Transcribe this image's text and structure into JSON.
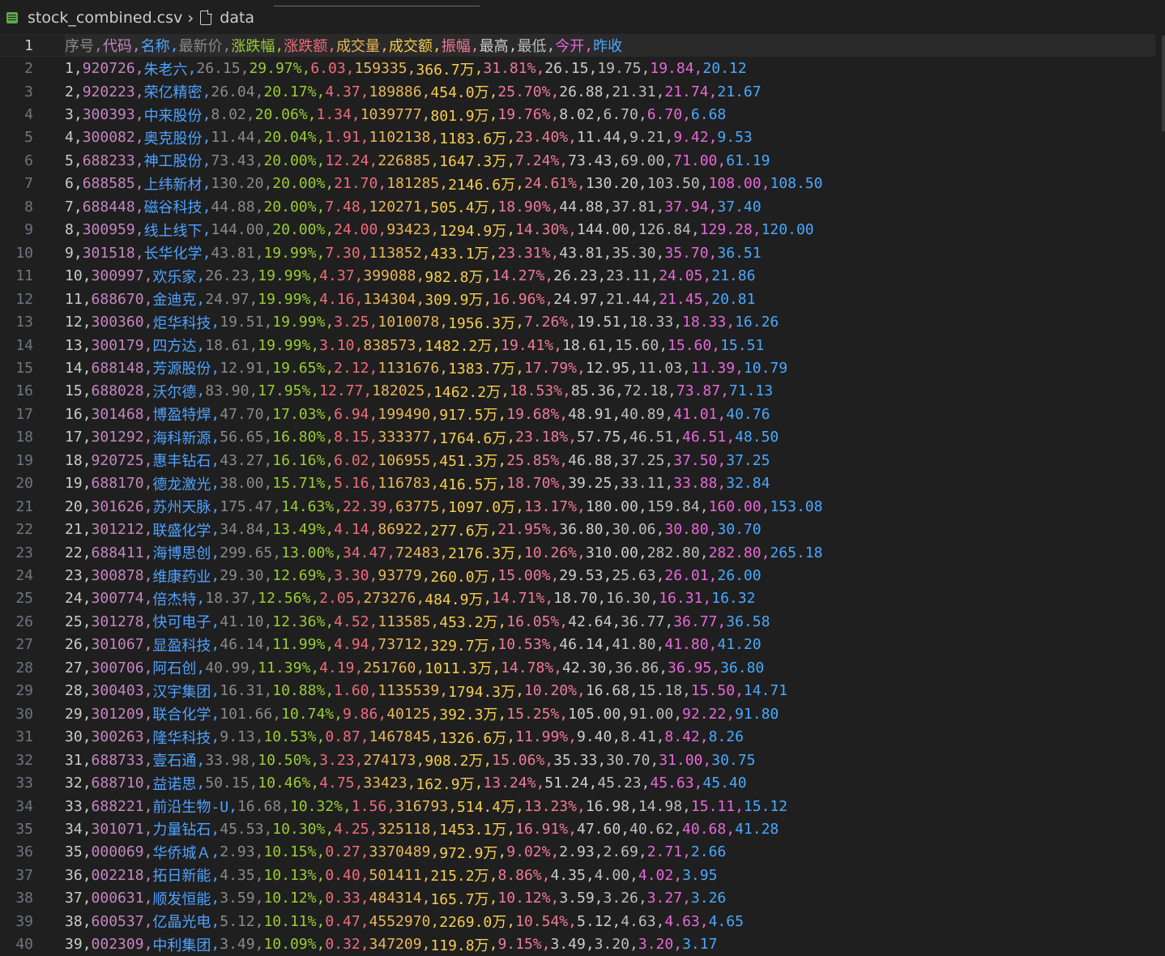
{
  "breadcrumb": {
    "file": "stock_combined.csv",
    "symbol": "data"
  },
  "editor": {
    "current_line": 1,
    "lines": [
      {
        "n": "1",
        "cells": [
          "序号",
          "代码",
          "名称",
          "最新价",
          "涨跌幅",
          "涨跌额",
          "成交量",
          "成交额",
          "振幅",
          "最高",
          "最低",
          "今开",
          "昨收"
        ]
      },
      {
        "n": "2",
        "cells": [
          "1",
          "920726",
          "朱老六",
          "26.15",
          "29.97%",
          "6.03",
          "159335",
          "366.7万",
          "31.81%",
          "26.15",
          "19.75",
          "19.84",
          "20.12"
        ]
      },
      {
        "n": "3",
        "cells": [
          "2",
          "920223",
          "荣亿精密",
          "26.04",
          "20.17%",
          "4.37",
          "189886",
          "454.0万",
          "25.70%",
          "26.88",
          "21.31",
          "21.74",
          "21.67"
        ]
      },
      {
        "n": "4",
        "cells": [
          "3",
          "300393",
          "中来股份",
          "8.02",
          "20.06%",
          "1.34",
          "1039777",
          "801.9万",
          "19.76%",
          "8.02",
          "6.70",
          "6.70",
          "6.68"
        ]
      },
      {
        "n": "5",
        "cells": [
          "4",
          "300082",
          "奥克股份",
          "11.44",
          "20.04%",
          "1.91",
          "1102138",
          "1183.6万",
          "23.40%",
          "11.44",
          "9.21",
          "9.42",
          "9.53"
        ]
      },
      {
        "n": "6",
        "cells": [
          "5",
          "688233",
          "神工股份",
          "73.43",
          "20.00%",
          "12.24",
          "226885",
          "1647.3万",
          "7.24%",
          "73.43",
          "69.00",
          "71.00",
          "61.19"
        ]
      },
      {
        "n": "7",
        "cells": [
          "6",
          "688585",
          "上纬新材",
          "130.20",
          "20.00%",
          "21.70",
          "181285",
          "2146.6万",
          "24.61%",
          "130.20",
          "103.50",
          "108.00",
          "108.50"
        ]
      },
      {
        "n": "8",
        "cells": [
          "7",
          "688448",
          "磁谷科技",
          "44.88",
          "20.00%",
          "7.48",
          "120271",
          "505.4万",
          "18.90%",
          "44.88",
          "37.81",
          "37.94",
          "37.40"
        ]
      },
      {
        "n": "9",
        "cells": [
          "8",
          "300959",
          "线上线下",
          "144.00",
          "20.00%",
          "24.00",
          "93423",
          "1294.9万",
          "14.30%",
          "144.00",
          "126.84",
          "129.28",
          "120.00"
        ]
      },
      {
        "n": "10",
        "cells": [
          "9",
          "301518",
          "长华化学",
          "43.81",
          "19.99%",
          "7.30",
          "113852",
          "433.1万",
          "23.31%",
          "43.81",
          "35.30",
          "35.70",
          "36.51"
        ]
      },
      {
        "n": "11",
        "cells": [
          "10",
          "300997",
          "欢乐家",
          "26.23",
          "19.99%",
          "4.37",
          "399088",
          "982.8万",
          "14.27%",
          "26.23",
          "23.11",
          "24.05",
          "21.86"
        ]
      },
      {
        "n": "12",
        "cells": [
          "11",
          "688670",
          "金迪克",
          "24.97",
          "19.99%",
          "4.16",
          "134304",
          "309.9万",
          "16.96%",
          "24.97",
          "21.44",
          "21.45",
          "20.81"
        ]
      },
      {
        "n": "13",
        "cells": [
          "12",
          "300360",
          "炬华科技",
          "19.51",
          "19.99%",
          "3.25",
          "1010078",
          "1956.3万",
          "7.26%",
          "19.51",
          "18.33",
          "18.33",
          "16.26"
        ]
      },
      {
        "n": "14",
        "cells": [
          "13",
          "300179",
          "四方达",
          "18.61",
          "19.99%",
          "3.10",
          "838573",
          "1482.2万",
          "19.41%",
          "18.61",
          "15.60",
          "15.60",
          "15.51"
        ]
      },
      {
        "n": "15",
        "cells": [
          "14",
          "688148",
          "芳源股份",
          "12.91",
          "19.65%",
          "2.12",
          "1131676",
          "1383.7万",
          "17.79%",
          "12.95",
          "11.03",
          "11.39",
          "10.79"
        ]
      },
      {
        "n": "16",
        "cells": [
          "15",
          "688028",
          "沃尔德",
          "83.90",
          "17.95%",
          "12.77",
          "182025",
          "1462.2万",
          "18.53%",
          "85.36",
          "72.18",
          "73.87",
          "71.13"
        ]
      },
      {
        "n": "17",
        "cells": [
          "16",
          "301468",
          "博盈特焊",
          "47.70",
          "17.03%",
          "6.94",
          "199490",
          "917.5万",
          "19.68%",
          "48.91",
          "40.89",
          "41.01",
          "40.76"
        ]
      },
      {
        "n": "18",
        "cells": [
          "17",
          "301292",
          "海科新源",
          "56.65",
          "16.80%",
          "8.15",
          "333377",
          "1764.6万",
          "23.18%",
          "57.75",
          "46.51",
          "46.51",
          "48.50"
        ]
      },
      {
        "n": "19",
        "cells": [
          "18",
          "920725",
          "惠丰钻石",
          "43.27",
          "16.16%",
          "6.02",
          "106955",
          "451.3万",
          "25.85%",
          "46.88",
          "37.25",
          "37.50",
          "37.25"
        ]
      },
      {
        "n": "20",
        "cells": [
          "19",
          "688170",
          "德龙激光",
          "38.00",
          "15.71%",
          "5.16",
          "116783",
          "416.5万",
          "18.70%",
          "39.25",
          "33.11",
          "33.88",
          "32.84"
        ]
      },
      {
        "n": "21",
        "cells": [
          "20",
          "301626",
          "苏州天脉",
          "175.47",
          "14.63%",
          "22.39",
          "63775",
          "1097.0万",
          "13.17%",
          "180.00",
          "159.84",
          "160.00",
          "153.08"
        ]
      },
      {
        "n": "22",
        "cells": [
          "21",
          "301212",
          "联盛化学",
          "34.84",
          "13.49%",
          "4.14",
          "86922",
          "277.6万",
          "21.95%",
          "36.80",
          "30.06",
          "30.80",
          "30.70"
        ]
      },
      {
        "n": "23",
        "cells": [
          "22",
          "688411",
          "海博思创",
          "299.65",
          "13.00%",
          "34.47",
          "72483",
          "2176.3万",
          "10.26%",
          "310.00",
          "282.80",
          "282.80",
          "265.18"
        ]
      },
      {
        "n": "24",
        "cells": [
          "23",
          "300878",
          "维康药业",
          "29.30",
          "12.69%",
          "3.30",
          "93779",
          "260.0万",
          "15.00%",
          "29.53",
          "25.63",
          "26.01",
          "26.00"
        ]
      },
      {
        "n": "25",
        "cells": [
          "24",
          "300774",
          "倍杰特",
          "18.37",
          "12.56%",
          "2.05",
          "273276",
          "484.9万",
          "14.71%",
          "18.70",
          "16.30",
          "16.31",
          "16.32"
        ]
      },
      {
        "n": "26",
        "cells": [
          "25",
          "301278",
          "快可电子",
          "41.10",
          "12.36%",
          "4.52",
          "113585",
          "453.2万",
          "16.05%",
          "42.64",
          "36.77",
          "36.77",
          "36.58"
        ]
      },
      {
        "n": "27",
        "cells": [
          "26",
          "301067",
          "显盈科技",
          "46.14",
          "11.99%",
          "4.94",
          "73712",
          "329.7万",
          "10.53%",
          "46.14",
          "41.80",
          "41.80",
          "41.20"
        ]
      },
      {
        "n": "28",
        "cells": [
          "27",
          "300706",
          "阿石创",
          "40.99",
          "11.39%",
          "4.19",
          "251760",
          "1011.3万",
          "14.78%",
          "42.30",
          "36.86",
          "36.95",
          "36.80"
        ]
      },
      {
        "n": "29",
        "cells": [
          "28",
          "300403",
          "汉宇集团",
          "16.31",
          "10.88%",
          "1.60",
          "1135539",
          "1794.3万",
          "10.20%",
          "16.68",
          "15.18",
          "15.50",
          "14.71"
        ]
      },
      {
        "n": "30",
        "cells": [
          "29",
          "301209",
          "联合化学",
          "101.66",
          "10.74%",
          "9.86",
          "40125",
          "392.3万",
          "15.25%",
          "105.00",
          "91.00",
          "92.22",
          "91.80"
        ]
      },
      {
        "n": "31",
        "cells": [
          "30",
          "300263",
          "隆华科技",
          "9.13",
          "10.53%",
          "0.87",
          "1467845",
          "1326.6万",
          "11.99%",
          "9.40",
          "8.41",
          "8.42",
          "8.26"
        ]
      },
      {
        "n": "32",
        "cells": [
          "31",
          "688733",
          "壹石通",
          "33.98",
          "10.50%",
          "3.23",
          "274173",
          "908.2万",
          "15.06%",
          "35.33",
          "30.70",
          "31.00",
          "30.75"
        ]
      },
      {
        "n": "33",
        "cells": [
          "32",
          "688710",
          "益诺思",
          "50.15",
          "10.46%",
          "4.75",
          "33423",
          "162.9万",
          "13.24%",
          "51.24",
          "45.23",
          "45.63",
          "45.40"
        ]
      },
      {
        "n": "34",
        "cells": [
          "33",
          "688221",
          "前沿生物-U",
          "16.68",
          "10.32%",
          "1.56",
          "316793",
          "514.4万",
          "13.23%",
          "16.98",
          "14.98",
          "15.11",
          "15.12"
        ]
      },
      {
        "n": "35",
        "cells": [
          "34",
          "301071",
          "力量钻石",
          "45.53",
          "10.30%",
          "4.25",
          "325118",
          "1453.1万",
          "16.91%",
          "47.60",
          "40.62",
          "40.68",
          "41.28"
        ]
      },
      {
        "n": "36",
        "cells": [
          "35",
          "000069",
          "华侨城Ａ",
          "2.93",
          "10.15%",
          "0.27",
          "3370489",
          "972.9万",
          "9.02%",
          "2.93",
          "2.69",
          "2.71",
          "2.66"
        ]
      },
      {
        "n": "37",
        "cells": [
          "36",
          "002218",
          "拓日新能",
          "4.35",
          "10.13%",
          "0.40",
          "501411",
          "215.2万",
          "8.86%",
          "4.35",
          "4.00",
          "4.02",
          "3.95"
        ]
      },
      {
        "n": "38",
        "cells": [
          "37",
          "000631",
          "顺发恒能",
          "3.59",
          "10.12%",
          "0.33",
          "484314",
          "165.7万",
          "10.12%",
          "3.59",
          "3.26",
          "3.27",
          "3.26"
        ]
      },
      {
        "n": "39",
        "cells": [
          "38",
          "600537",
          "亿晶光电",
          "5.12",
          "10.11%",
          "0.47",
          "4552970",
          "2269.0万",
          "10.54%",
          "5.12",
          "4.63",
          "4.63",
          "4.65"
        ]
      },
      {
        "n": "40",
        "cells": [
          "39",
          "002309",
          "中利集团",
          "3.49",
          "10.09%",
          "0.32",
          "347209",
          "119.8万",
          "9.15%",
          "3.49",
          "3.20",
          "3.20",
          "3.17"
        ]
      }
    ]
  }
}
